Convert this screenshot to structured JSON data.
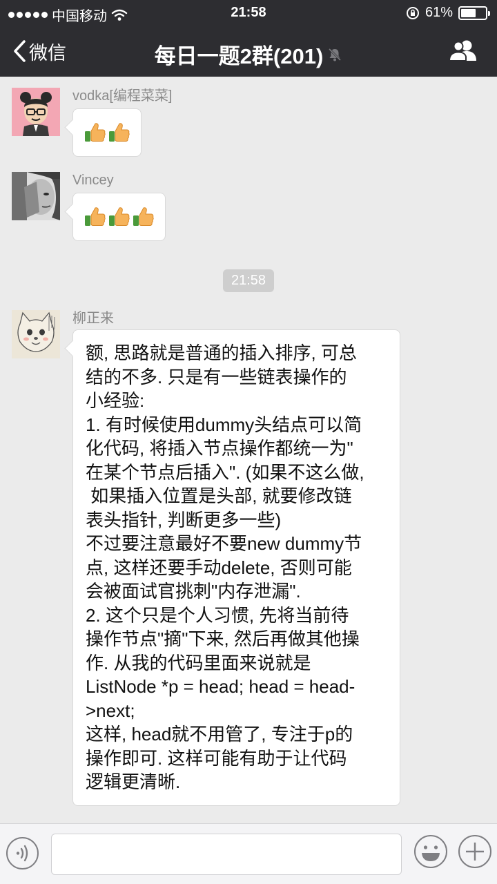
{
  "status_bar": {
    "carrier": "中国移动",
    "time": "21:58",
    "battery_percent": "61%",
    "battery_level": 0.61,
    "icons": [
      "signal-dots-icon",
      "wifi-icon",
      "orientation-lock-icon",
      "battery-icon"
    ]
  },
  "nav": {
    "back_label": "微信",
    "title": "每日一题2群(201)",
    "icons": [
      "chevron-left-icon",
      "mute-bell-icon",
      "group-members-icon"
    ]
  },
  "messages": [
    {
      "sender": "vodka[编程菜菜]",
      "content_type": "emoji",
      "emoji_count": 2,
      "emoji": "thumbs-up"
    },
    {
      "sender": "Vincey",
      "content_type": "emoji",
      "emoji_count": 3,
      "emoji": "thumbs-up"
    },
    {
      "sender": "柳正来",
      "content_type": "text",
      "lines": [
        "额, 思路就是普通的插入排序, 可总",
        "结的不多. 只是有一些链表操作的",
        "小经验:",
        "1. 有时候使用dummy头结点可以简",
        "化代码, 将插入节点操作都统一为\"",
        "在某个节点后插入\". (如果不这么做,",
        " 如果插入位置是头部, 就要修改链",
        "表头指针, 判断更多一些)",
        "不过要注意最好不要new dummy节",
        "点, 这样还要手动delete, 否则可能",
        "会被面试官挑刺\"内存泄漏\".",
        "2. 这个只是个人习惯, 先将当前待",
        "操作节点\"摘\"下来, 然后再做其他操",
        "作. 从我的代码里面来说就是",
        "ListNode *p = head; head = head-",
        ">next;",
        "这样, head就不用管了, 专注于p的",
        "操作即可. 这样可能有助于让代码",
        "逻辑更清晰."
      ]
    }
  ],
  "timestamp": "21:58",
  "input_bar": {
    "value": "",
    "icons": [
      "voice-icon",
      "emoji-icon",
      "plus-icon"
    ]
  },
  "colors": {
    "nav_bg": "#2d2d31",
    "chat_bg": "#ebebeb",
    "bubble_bg": "#ffffff",
    "timestamp_bg": "#cecece"
  }
}
